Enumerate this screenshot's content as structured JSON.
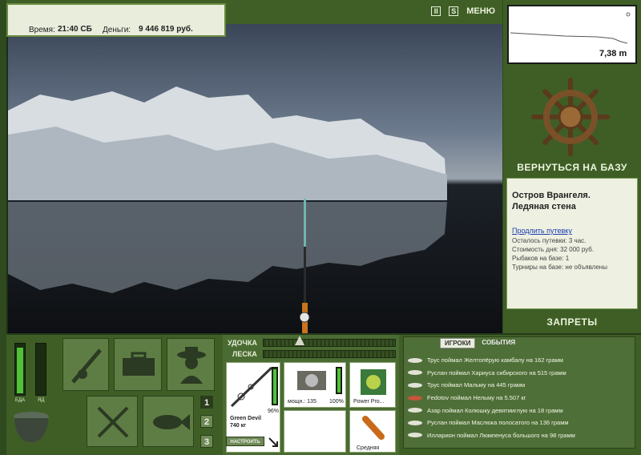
{
  "hud": {
    "time_label": "Время:",
    "time_value": "21:40 СБ",
    "money_label": "Деньги:",
    "money_value": "9 446 819 руб.",
    "pause_icon": "II",
    "sound_icon": "S",
    "menu_label": "МЕНЮ"
  },
  "depth": {
    "value": "7,38 m"
  },
  "right_panel": {
    "return_label": "ВЕРНУТЬСЯ НА БАЗУ",
    "location_line1": "Остров Врангеля.",
    "location_line2": "Ледяная стена",
    "extend_link": "Продлить путевку",
    "info": [
      "Осталось путевки: 3 час.",
      "Стоимость дня: 32 000 руб.",
      "Рыбаков на базе: 1",
      "Турниры на базе: не объявлены"
    ],
    "bans_label": "ЗАПРЕТЫ"
  },
  "status": {
    "food_label": "ЕДА",
    "poison_label": "ЯД",
    "food_level": 0.92,
    "poison_level": 0.0
  },
  "slots": [
    "1",
    "2",
    "3"
  ],
  "gear": {
    "rod_label": "УДОЧКА",
    "line_label": "ЛЕСКА",
    "rod_name": "Green Devil",
    "rod_weight": "740 кг",
    "rod_percent": "96%",
    "reel_power": "мощн.: 135",
    "reel_percent": "100%",
    "line_name": "Power Pro...",
    "bait_name": "Средняя",
    "setup_button": "НАСТРОИТЬ"
  },
  "log": {
    "tab_players": "ИГРОКИ",
    "tab_events": "СОБЫТИЯ",
    "entries": [
      "Трус поймал Желтопёрую камбалу на 162 грамм",
      "Руслан поймал Хариуса сибирского на 515 грамм",
      "Трус поймал Мальму на 445 грамм",
      "Fedotov поймал Нельму на 5.507 кг",
      "Азар поймал Колюшку девятииглую на 18 грамм",
      "Руслан поймал Маслюка полосатого на 136 грамм",
      "Илларион поймал Люмпенуса большого на 98 грамм"
    ]
  },
  "icons": [
    "pause-icon",
    "sound-icon",
    "ship-wheel-icon",
    "rod-reel-icon",
    "tackle-box-icon",
    "fisherman-icon",
    "cutlery-icon",
    "fish-icon",
    "pot-icon",
    "arrow-icon"
  ]
}
